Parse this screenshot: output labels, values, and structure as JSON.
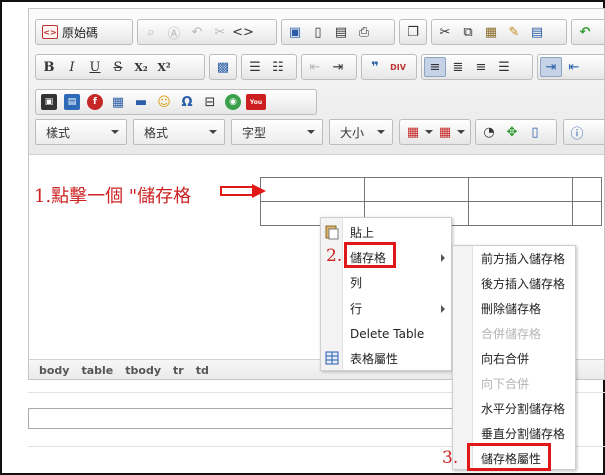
{
  "toolbar": {
    "source_label": "原始碼",
    "combos": [
      {
        "name": "styles-combo",
        "label": "樣式"
      },
      {
        "name": "format-combo",
        "label": "格式"
      },
      {
        "name": "font-combo",
        "label": "字型"
      },
      {
        "name": "size-combo",
        "label": "大小"
      }
    ],
    "bold_label": "B",
    "italic_label": "I",
    "underline_label": "U",
    "strike_label": "S",
    "subscript_label": "X₂",
    "superscript_label": "X²",
    "omega_label": "Ω",
    "youtube_label": "You",
    "div_label": "DIV",
    "quote_label": "❞"
  },
  "annotation": {
    "step1": "1.點擊一個 \"儲存格",
    "step2": "2.",
    "step3": "3."
  },
  "statusbar": {
    "items": [
      "body",
      "table",
      "tbody",
      "tr",
      "td"
    ]
  },
  "context_menu": {
    "items": [
      {
        "label": "貼上",
        "has_sub": false
      },
      {
        "label": "儲存格",
        "has_sub": true
      },
      {
        "label": "列",
        "has_sub": false
      },
      {
        "label": "行",
        "has_sub": true
      },
      {
        "label": "Delete Table",
        "has_sub": false
      },
      {
        "label": "表格屬性",
        "has_sub": false
      }
    ]
  },
  "cell_submenu": {
    "items": [
      {
        "label": "前方插入儲存格",
        "disabled": false
      },
      {
        "label": "後方插入儲存格",
        "disabled": false
      },
      {
        "label": "刪除儲存格",
        "disabled": false
      },
      {
        "label": "合併儲存格",
        "disabled": true
      },
      {
        "label": "向右合併",
        "disabled": false
      },
      {
        "label": "向下合併",
        "disabled": true
      },
      {
        "label": "水平分割儲存格",
        "disabled": false
      },
      {
        "label": "垂直分割儲存格",
        "disabled": false
      },
      {
        "label": "儲存格屬性",
        "disabled": false
      }
    ]
  },
  "colors": {
    "highlight": "#e01818",
    "annotation": "#cc2222"
  }
}
